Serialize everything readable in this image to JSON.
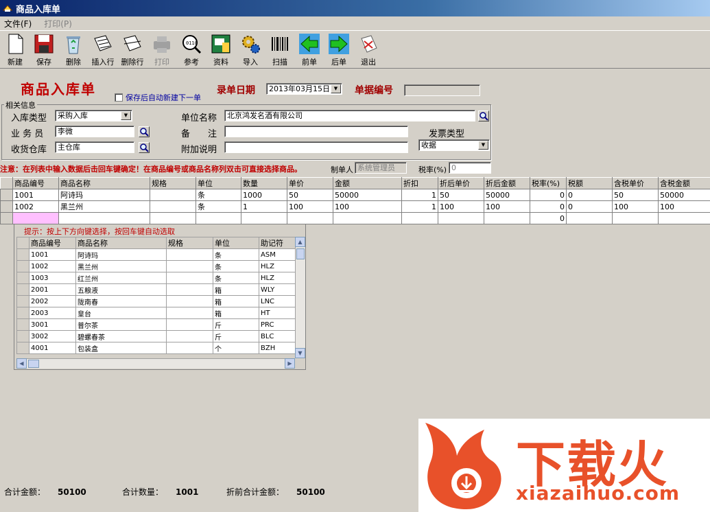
{
  "window": {
    "title": "商品入库单"
  },
  "menu": {
    "file": "文件(F)",
    "print": "打印(P)"
  },
  "toolbar": {
    "new": "新建",
    "save": "保存",
    "delete": "删除",
    "insert_row": "插入行",
    "delete_row": "删除行",
    "print": "打印",
    "reference": "参考",
    "data": "资料",
    "import": "导入",
    "scan": "扫描",
    "prev": "前单",
    "next": "后单",
    "exit": "退出"
  },
  "form": {
    "title": "商品入库单",
    "auto_new_label": "保存后自动新建下一单",
    "date_label": "录单日期",
    "date_value": "2013年03月15日",
    "doc_no_label": "单据编号",
    "doc_no_value": "",
    "group_title": "相关信息",
    "stock_type_label": "入库类型",
    "stock_type_value": "采购入库",
    "salesman_label": "业 务 员",
    "salesman_value": "李微",
    "warehouse_label": "收货仓库",
    "warehouse_value": "主仓库",
    "unit_name_label": "单位名称",
    "unit_name_value": "北京鸿发名酒有限公司",
    "remark_label": "备　　注",
    "remark_value": "",
    "extra_label": "附加说明",
    "extra_value": "",
    "invoice_type_label": "发票类型",
    "invoice_type_value": "收据",
    "note": "注意：在列表中输入数据后击回车键确定！在商品编号或商品名称列双击可直接选择商品。",
    "maker_label": "制单人",
    "maker_value": "系统管理员",
    "tax_rate_label": "税率(%)",
    "tax_rate_value": "0"
  },
  "grid": {
    "columns": [
      "商品编号",
      "商品名称",
      "规格",
      "单位",
      "数量",
      "单价",
      "金额",
      "折扣",
      "折后单价",
      "折后金额",
      "税率(%)",
      "税额",
      "含税单价",
      "含税金额"
    ],
    "rows": [
      [
        "1001",
        "阿诗玛",
        "",
        "条",
        "1000",
        "50",
        "50000",
        "1",
        "50",
        "50000",
        "0",
        "0",
        "50",
        "50000"
      ],
      [
        "1002",
        "黑兰州",
        "",
        "条",
        "1",
        "100",
        "100",
        "1",
        "100",
        "100",
        "0",
        "0",
        "100",
        "100"
      ],
      [
        "",
        "",
        "",
        "",
        "",
        "",
        "",
        "",
        "",
        "",
        "0",
        "",
        "",
        ""
      ]
    ]
  },
  "popup": {
    "hint": "提示：按上下方向键选择，按回车键自动选取",
    "columns": [
      "商品编号",
      "商品名称",
      "规格",
      "单位",
      "助记符"
    ],
    "rows": [
      [
        "1001",
        "阿诗玛",
        "",
        "条",
        "ASM"
      ],
      [
        "1002",
        "黑兰州",
        "",
        "条",
        "HLZ"
      ],
      [
        "1003",
        "红兰州",
        "",
        "条",
        "HLZ"
      ],
      [
        "2001",
        "五粮液",
        "",
        "箱",
        "WLY"
      ],
      [
        "2002",
        "陇南春",
        "",
        "箱",
        "LNC"
      ],
      [
        "2003",
        "皇台",
        "",
        "箱",
        "HT"
      ],
      [
        "3001",
        "普尔茶",
        "",
        "斤",
        "PRC"
      ],
      [
        "3002",
        "碧螺春茶",
        "",
        "斤",
        "BLC"
      ],
      [
        "4001",
        "包装盒",
        "",
        "个",
        "BZH"
      ]
    ]
  },
  "footer": {
    "total_amount_label": "合计金额：",
    "total_amount_value": "50100",
    "total_qty_label": "合计数量：",
    "total_qty_value": "1001",
    "pre_discount_label": "折前合计金额：",
    "pre_discount_value": "50100"
  },
  "watermark": {
    "logo_text": "下载火",
    "site": "xiazaihuo.com"
  },
  "colors": {
    "title_red": "#c00000",
    "label_red": "#a00000",
    "edit_cell": "#ffc0ff",
    "watermark": "#e8512a"
  }
}
